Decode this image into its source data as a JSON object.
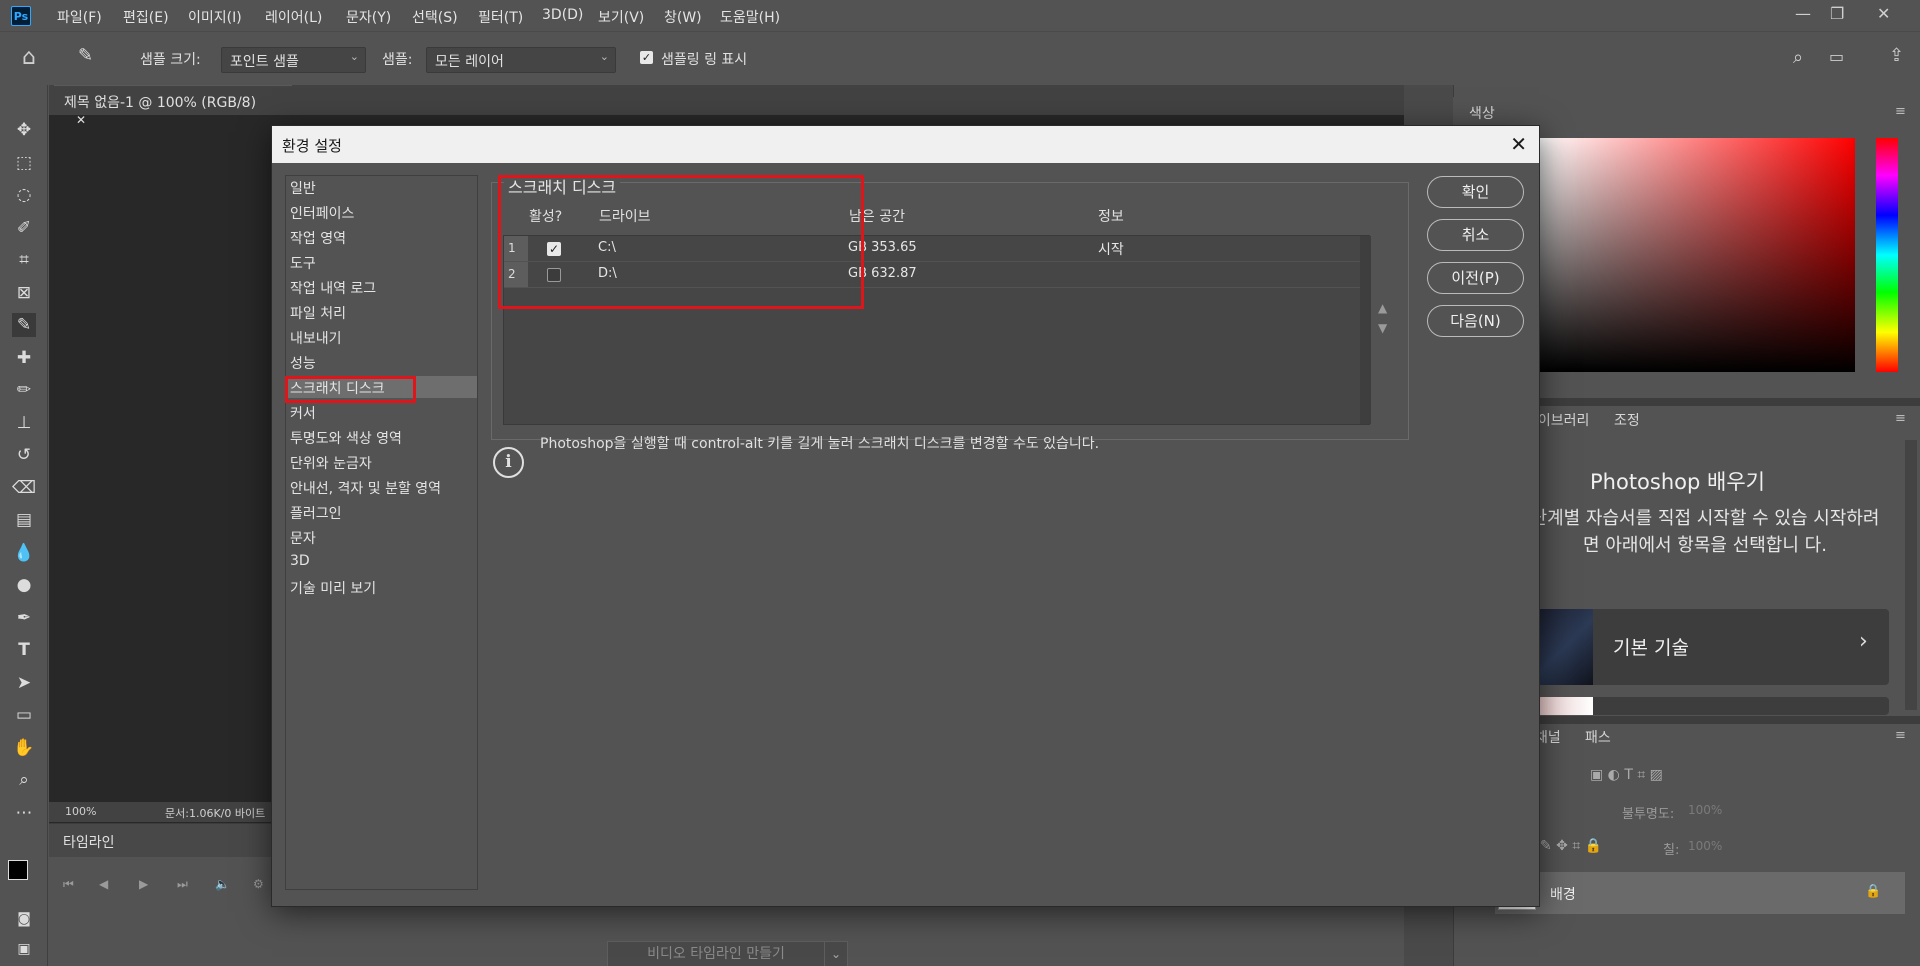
{
  "app": {
    "logo": "Ps"
  },
  "menu": [
    "파일(F)",
    "편집(E)",
    "이미지(I)",
    "레이어(L)",
    "문자(Y)",
    "선택(S)",
    "필터(T)",
    "3D(D)",
    "보기(V)",
    "창(W)",
    "도움말(H)"
  ],
  "window_controls": {
    "minimize": "—",
    "restore": "❐",
    "close": "✕"
  },
  "options": {
    "sample_size_label": "샘플 크기:",
    "sample_size_value": "포인트 샘플",
    "sample_label": "샘플:",
    "sample_value": "모든 레이어",
    "show_ring_label": "샘플링 링 표시"
  },
  "document": {
    "tab_title": "제목 없음-1 @ 100% (RGB/8)",
    "tab_close": "✕",
    "zoom": "100%",
    "doc_info": "문서:1.06K/0 바이트"
  },
  "timeline": {
    "tab": "타임라인",
    "create_button": "비디오 타임라인 만들기"
  },
  "right_panels": {
    "color_tab": "색상",
    "library_tab": "라이브러리",
    "adjust_tab": "조정",
    "learn_title": "Photoshop 배우기",
    "learn_text": "단계별 자습서를 직접 시작할 수 있습 시작하려면 아래에서 항목을 선택합니 다.",
    "learn_card_1": "기본 기술",
    "channels_tab": "채널",
    "paths_tab": "패스",
    "opacity_label": "불투명도:",
    "opacity_value": "100%",
    "fill_label": "칠:",
    "fill_value": "100%",
    "layer_name": "배경"
  },
  "dialog": {
    "title": "환경 설정",
    "close": "✕",
    "nav": [
      "일반",
      "인터페이스",
      "작업 영역",
      "도구",
      "작업 내역 로그",
      "파일 처리",
      "내보내기",
      "성능",
      "스크래치 디스크",
      "커서",
      "투명도와 색상 영역",
      "단위와 눈금자",
      "안내선, 격자 및 분할 영역",
      "플러그인",
      "문자",
      "3D",
      "기술 미리 보기"
    ],
    "selected_nav": "스크래치 디스크",
    "group_title": "스크래치 디스크",
    "columns": {
      "active": "활성?",
      "drive": "드라이브",
      "free": "남은 공간",
      "info": "정보"
    },
    "rows": [
      {
        "num": "1",
        "active": true,
        "drive": "C:\\",
        "free": "GB 353.65",
        "info": "시작"
      },
      {
        "num": "2",
        "active": false,
        "drive": "D:\\",
        "free": "GB 632.87",
        "info": ""
      }
    ],
    "buttons": {
      "ok": "확인",
      "cancel": "취소",
      "prev": "이전(P)",
      "next": "다음(N)"
    },
    "info_icon": "i",
    "info_text": "Photoshop을 실행할 때 control-alt 키를 길게 눌러 스크래치 디스크를 변경할 수도 있습니다.",
    "move_up": "▲",
    "move_down": "▼"
  }
}
